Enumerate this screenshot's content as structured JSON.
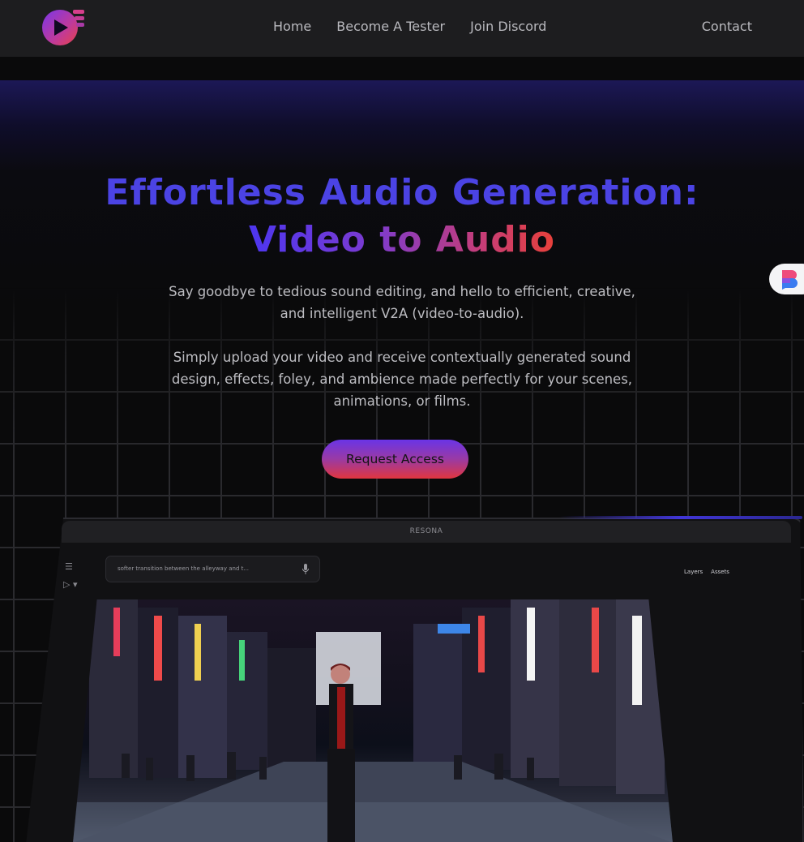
{
  "nav": {
    "links": [
      "Home",
      "Become A Tester",
      "Join Discord"
    ],
    "contact": "Contact"
  },
  "hero": {
    "title_line1": "Effortless Audio Generation:",
    "title_line2": "Video to Audio",
    "paragraph1": "Say goodbye to tedious sound editing, and hello to efficient, creative, and intelligent V2A (video-to-audio).",
    "paragraph2": "Simply upload your video and receive contextually generated sound design, effects, foley, and ambience made perfectly for your scenes, animations, or films.",
    "cta": "Request Access"
  },
  "app_mockup": {
    "window_title": "RESONA",
    "prompt_text": "softer transition between the alleyway and t...",
    "tabs": [
      "Layers",
      "Assets"
    ]
  },
  "colors": {
    "title_blue": "#4b43e4",
    "gradient_start": "#4d36f0",
    "gradient_end": "#e8403a",
    "nav_bg": "#1d1d1f",
    "page_bg": "#0a0a0b"
  },
  "icons": [
    "logo-icon",
    "menu-icon",
    "play-select-icon",
    "microphone-icon",
    "floating-app-icon"
  ]
}
